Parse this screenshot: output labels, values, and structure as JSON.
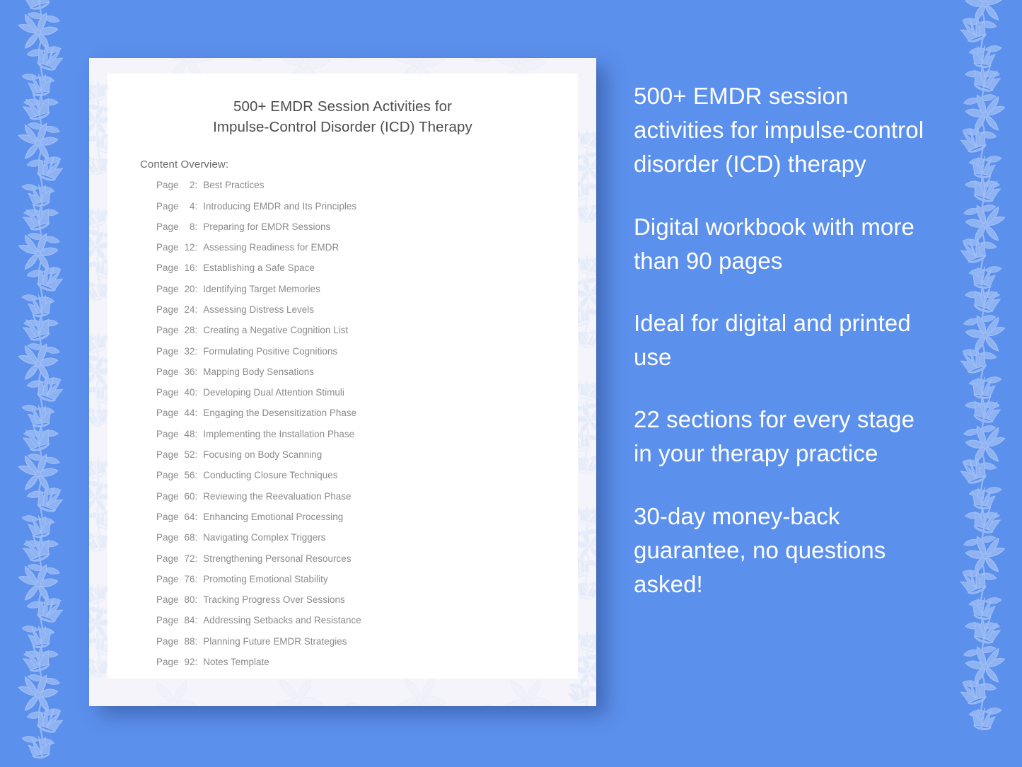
{
  "theme": {
    "background_color": "#5c90ed",
    "card_frame_color": "#f5f4fa",
    "page_color": "#ffffff",
    "title_color": "#4d4d4d",
    "list_text_color": "#8a8a8a",
    "marketing_text_color": "#ffffff"
  },
  "document": {
    "title_line_1": "500+ EMDR Session Activities for",
    "title_line_2": "Impulse-Control Disorder (ICD) Therapy",
    "content_overview_label": "Content Overview:",
    "page_word": "Page",
    "colon": ":",
    "toc": [
      {
        "page": "2",
        "title": "Best Practices"
      },
      {
        "page": "4",
        "title": "Introducing EMDR and Its Principles"
      },
      {
        "page": "8",
        "title": "Preparing for EMDR Sessions"
      },
      {
        "page": "12",
        "title": "Assessing Readiness for EMDR"
      },
      {
        "page": "16",
        "title": "Establishing a Safe Space"
      },
      {
        "page": "20",
        "title": "Identifying Target Memories"
      },
      {
        "page": "24",
        "title": "Assessing Distress Levels"
      },
      {
        "page": "28",
        "title": "Creating a Negative Cognition List"
      },
      {
        "page": "32",
        "title": "Formulating Positive Cognitions"
      },
      {
        "page": "36",
        "title": "Mapping Body Sensations"
      },
      {
        "page": "40",
        "title": "Developing Dual Attention Stimuli"
      },
      {
        "page": "44",
        "title": "Engaging the Desensitization Phase"
      },
      {
        "page": "48",
        "title": "Implementing the Installation Phase"
      },
      {
        "page": "52",
        "title": "Focusing on Body Scanning"
      },
      {
        "page": "56",
        "title": "Conducting Closure Techniques"
      },
      {
        "page": "60",
        "title": "Reviewing the Reevaluation Phase"
      },
      {
        "page": "64",
        "title": "Enhancing Emotional Processing"
      },
      {
        "page": "68",
        "title": "Navigating Complex Triggers"
      },
      {
        "page": "72",
        "title": "Strengthening Personal Resources"
      },
      {
        "page": "76",
        "title": "Promoting Emotional Stability"
      },
      {
        "page": "80",
        "title": "Tracking Progress Over Sessions"
      },
      {
        "page": "84",
        "title": "Addressing Setbacks and Resistance"
      },
      {
        "page": "88",
        "title": "Planning Future EMDR Strategies"
      },
      {
        "page": "92",
        "title": "Notes Template"
      }
    ]
  },
  "marketing": {
    "bullets": [
      "500+ EMDR session activities for impulse-control disorder (ICD) therapy",
      "Digital workbook with more than 90 pages",
      "Ideal for digital and printed use",
      "22 sections for every stage in your therapy practice",
      "30-day money-back guarantee, no questions asked!"
    ]
  },
  "decoration": {
    "left_border": "floral-vine-icon",
    "right_border": "floral-vine-icon",
    "card_watermark": "floral-mandala-watermark-icon"
  }
}
